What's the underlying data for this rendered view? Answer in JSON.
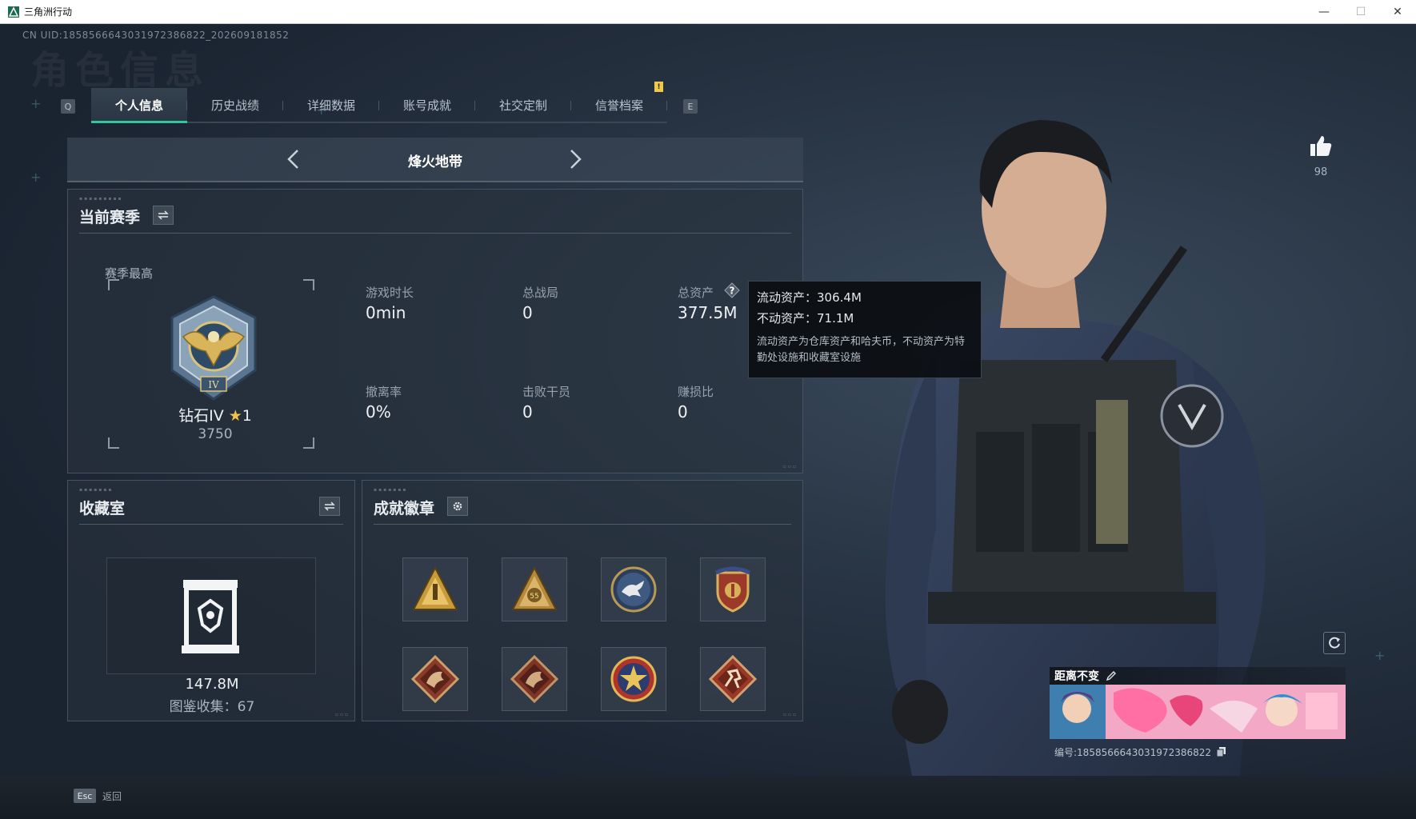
{
  "window": {
    "title": "三角洲行动",
    "minimize": "—",
    "maximize": "☐",
    "close": "✕"
  },
  "uid_line": "CN UID:1858566643031972386822_202609181852",
  "watermark": "角色信息",
  "tabs": {
    "prev_key": "Q",
    "next_key": "E",
    "items": [
      {
        "label": "个人信息",
        "active": true
      },
      {
        "label": "历史战绩",
        "active": false
      },
      {
        "label": "详细数据",
        "active": false
      },
      {
        "label": "账号成就",
        "active": false
      },
      {
        "label": "社交定制",
        "active": false,
        "alert": "!"
      },
      {
        "label": "信誉档案",
        "active": false
      }
    ]
  },
  "mode": {
    "title": "烽火地带"
  },
  "season": {
    "title": "当前赛季",
    "highest_label": "赛季最高",
    "rank_name": "钻石IV",
    "rank_star": "★",
    "rank_star_count": "1",
    "rank_score": "3750",
    "stats": {
      "playtime": {
        "label": "游戏时长",
        "value": "0min"
      },
      "matches": {
        "label": "总战局",
        "value": "0"
      },
      "assets": {
        "label": "总资产",
        "value": "377.5M"
      },
      "extract_rate": {
        "label": "撤离率",
        "value": "0%"
      },
      "kills": {
        "label": "击败干员",
        "value": "0"
      },
      "profit_ratio": {
        "label": "赚损比",
        "value": "0"
      }
    }
  },
  "tooltip": {
    "liquid": "流动资产：306.4M",
    "fixed": "不动资产：71.1M",
    "desc": "流动资产为仓库资产和哈夫币，不动资产为特勤处设施和收藏室设施"
  },
  "collection": {
    "title": "收藏室",
    "value": "147.8M",
    "count": "图鉴收集：67"
  },
  "achievements": {
    "title": "成就徽章",
    "badges": [
      {
        "icon": "gold-triangle-badge-icon"
      },
      {
        "icon": "gold-triangle-55-badge-icon"
      },
      {
        "icon": "eagle-round-badge-icon"
      },
      {
        "icon": "shield-stars-badge-icon"
      },
      {
        "icon": "dragon-diamond-badge-icon"
      },
      {
        "icon": "dragon-diamond-badge-icon"
      },
      {
        "icon": "star-round-badge-icon"
      },
      {
        "icon": "runner-diamond-badge-icon"
      }
    ]
  },
  "profile": {
    "likes": "98",
    "nameplate_title": "距离不变",
    "nameplate_id": "编号:1858566643031972386822"
  },
  "footer": {
    "esc_key": "Esc",
    "esc_label": "返回"
  },
  "colors": {
    "accent": "#2ec89a",
    "alert": "#f2c84a",
    "star": "#f0c24b"
  }
}
